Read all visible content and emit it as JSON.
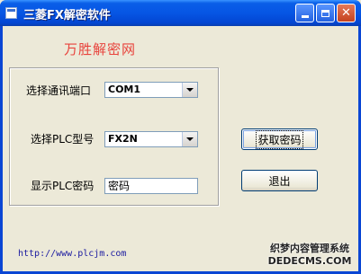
{
  "window": {
    "title": "三菱FX解密软件",
    "buttons": {
      "minimize": "_",
      "maximize": "□",
      "close": "✕"
    }
  },
  "brand": "万胜解密网",
  "form": {
    "port_label": "选择通讯端口",
    "port_value": "COM1",
    "model_label": "选择PLC型号",
    "model_value": "FX2N",
    "password_label": "显示PLC密码",
    "password_value": "密码"
  },
  "actions": {
    "get_password": "获取密码",
    "exit": "退出"
  },
  "footer": {
    "url": "http://www.plcjm.com"
  },
  "watermark": {
    "line1": "织梦内容管理系统",
    "line2": "DEDECMS.COM"
  },
  "icons": {
    "app": "app-icon",
    "dropdown": "chevron-down-icon"
  },
  "colors": {
    "titlebar": "#0655e4",
    "brand": "#e8433c",
    "link": "#1a1aa0",
    "background": "#ece9d8"
  }
}
